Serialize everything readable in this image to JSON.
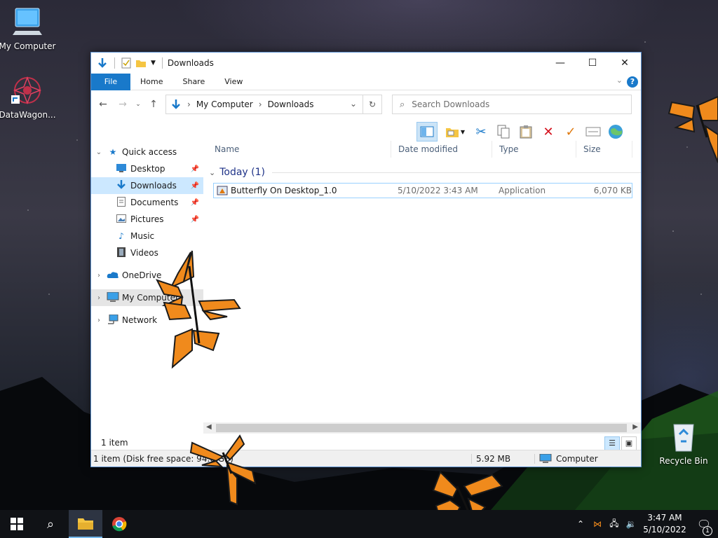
{
  "desktop": {
    "icons": [
      {
        "label": "My Computer",
        "icon": "computer-icon"
      },
      {
        "label": "DataWagon...",
        "icon": "shortcut-icon"
      },
      {
        "label": "Recycle Bin",
        "icon": "recycle-bin-icon"
      }
    ]
  },
  "window": {
    "title": "Downloads",
    "ribbon_tabs": [
      "File",
      "Home",
      "Share",
      "View"
    ],
    "help": "?",
    "controls": {
      "minimize": "—",
      "maximize": "☐",
      "close": "✕"
    }
  },
  "address": {
    "crumbs": [
      "My Computer",
      "Downloads"
    ],
    "search_placeholder": "Search Downloads"
  },
  "nav_pane": {
    "items": [
      {
        "label": "Quick access",
        "icon": "star-icon",
        "expand": "⌄"
      },
      {
        "label": "Desktop",
        "icon": "desktop-icon",
        "pinned": true
      },
      {
        "label": "Downloads",
        "icon": "download-icon",
        "pinned": true,
        "selected": true
      },
      {
        "label": "Documents",
        "icon": "documents-icon",
        "pinned": true
      },
      {
        "label": "Pictures",
        "icon": "pictures-icon",
        "pinned": true
      },
      {
        "label": "Music",
        "icon": "music-icon"
      },
      {
        "label": "Videos",
        "icon": "videos-icon"
      },
      {
        "label": "OneDrive",
        "icon": "onedrive-icon",
        "expand": "›"
      },
      {
        "label": "My Computer",
        "icon": "computer-icon",
        "expand": "›"
      },
      {
        "label": "Network",
        "icon": "network-icon",
        "expand": "›"
      }
    ]
  },
  "columns": [
    "Name",
    "Date modified",
    "Type",
    "Size"
  ],
  "group": {
    "label": "Today (1)"
  },
  "files": [
    {
      "name": "Butterfly On Desktop_1.0",
      "date": "5/10/2022 3:43 AM",
      "type": "Application",
      "size": "6,070 KB"
    }
  ],
  "item_count": "1 item",
  "status": {
    "left": "1 item (Disk free space: 94.0 GB)",
    "size": "5.92 MB",
    "location": "Computer"
  },
  "taskbar": {
    "clock_time": "3:47 AM",
    "clock_date": "5/10/2022",
    "notification_count": "1"
  },
  "colors": {
    "accent": "#1979ca",
    "selection": "#cce8ff",
    "butterfly": "#f08a1c"
  }
}
